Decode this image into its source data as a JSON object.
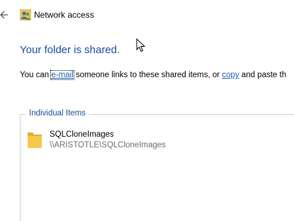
{
  "window": {
    "title": "Network access",
    "back_icon": "back-arrow-icon",
    "app_icon": "network-users-icon"
  },
  "main": {
    "heading": "Your folder is shared.",
    "message": {
      "prefix": "You can ",
      "email_link": "e-mail",
      "middle": " someone links to these shared items, or ",
      "copy_link": "copy",
      "suffix": " and paste th"
    },
    "items_group": {
      "legend": "Individual Items",
      "items": [
        {
          "name": "SQLCloneImages",
          "path": "\\\\ARISTOTLE\\SQLCloneImages",
          "icon": "folder-icon"
        }
      ]
    }
  },
  "colors": {
    "heading": "#1a4a9c",
    "link": "#1a5fb4",
    "secondary_text": "#6e6e6e",
    "folder": "#f4c542"
  }
}
